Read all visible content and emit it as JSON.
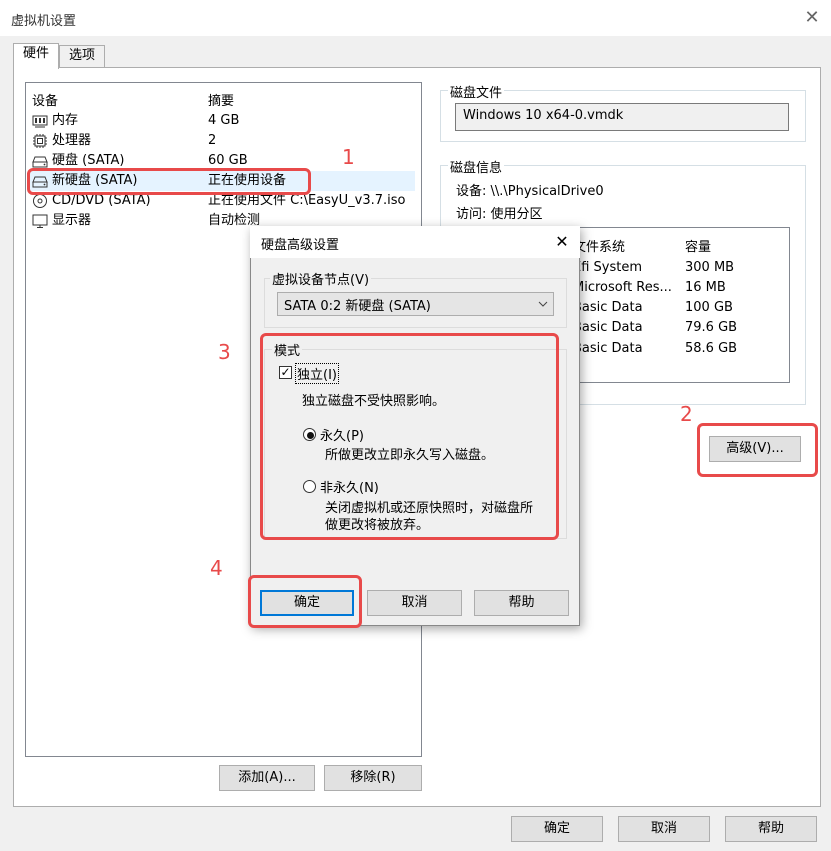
{
  "window": {
    "title": "虚拟机设置",
    "close_glyph": "✕"
  },
  "tabs": [
    {
      "label": "硬件"
    },
    {
      "label": "选项"
    }
  ],
  "device_list": {
    "col_device": "设备",
    "col_summary": "摘要",
    "rows": [
      {
        "device": "内存",
        "summary": "4 GB",
        "icon": "memory-icon"
      },
      {
        "device": "处理器",
        "summary": "2",
        "icon": "cpu-icon"
      },
      {
        "device": "硬盘 (SATA)",
        "summary": "60 GB",
        "icon": "disk-icon"
      },
      {
        "device": "新硬盘 (SATA)",
        "summary": "正在使用设备",
        "icon": "disk-icon"
      },
      {
        "device": "CD/DVD (SATA)",
        "summary": "正在使用文件 C:\\EasyU_v3.7.iso",
        "icon": "cd-icon"
      },
      {
        "device": "显示器",
        "summary": "自动检测",
        "icon": "monitor-icon"
      }
    ],
    "add_button": "添加(A)...",
    "remove_button": "移除(R)"
  },
  "disk_file": {
    "label": "磁盘文件",
    "value": "Windows 10 x64-0.vmdk"
  },
  "disk_info": {
    "label": "磁盘信息",
    "device_line": "设备: \\\\.\\PhysicalDrive0",
    "access_line": "访问: 使用分区",
    "col_fs": "文件系统",
    "col_cap": "容量",
    "partitions": [
      {
        "fs": "Efi System",
        "cap": "300 MB"
      },
      {
        "fs": "Microsoft Res...",
        "cap": "16 MB"
      },
      {
        "fs": "Basic Data",
        "cap": "100 GB"
      },
      {
        "fs": "Basic Data",
        "cap": "79.6 GB"
      },
      {
        "fs": "Basic Data",
        "cap": "58.6 GB"
      }
    ]
  },
  "advanced_button": "高级(V)...",
  "footer": {
    "ok": "确定",
    "cancel": "取消",
    "help": "帮助"
  },
  "dialog": {
    "title": "硬盘高级设置",
    "close_glyph": "✕",
    "node_label": "虚拟设备节点(V)",
    "node_value": "SATA 0:2   新硬盘 (SATA)",
    "mode_label": "模式",
    "independent_label": "独立(I)",
    "independent_checked": true,
    "independent_desc": "独立磁盘不受快照影响。",
    "persistent_label": "永久(P)",
    "persistent_desc": "所做更改立即永久写入磁盘。",
    "nonpersistent_label": "非永久(N)",
    "nonpersistent_desc_1": "关闭虚拟机或还原快照时，对磁盘所",
    "nonpersistent_desc_2": "做更改将被放弃。",
    "selected_mode": "persistent",
    "ok": "确定",
    "cancel": "取消",
    "help": "帮助"
  },
  "annotations": {
    "n1": "1",
    "n2": "2",
    "n3": "3",
    "n4": "4",
    "color": "#e84a4a"
  }
}
